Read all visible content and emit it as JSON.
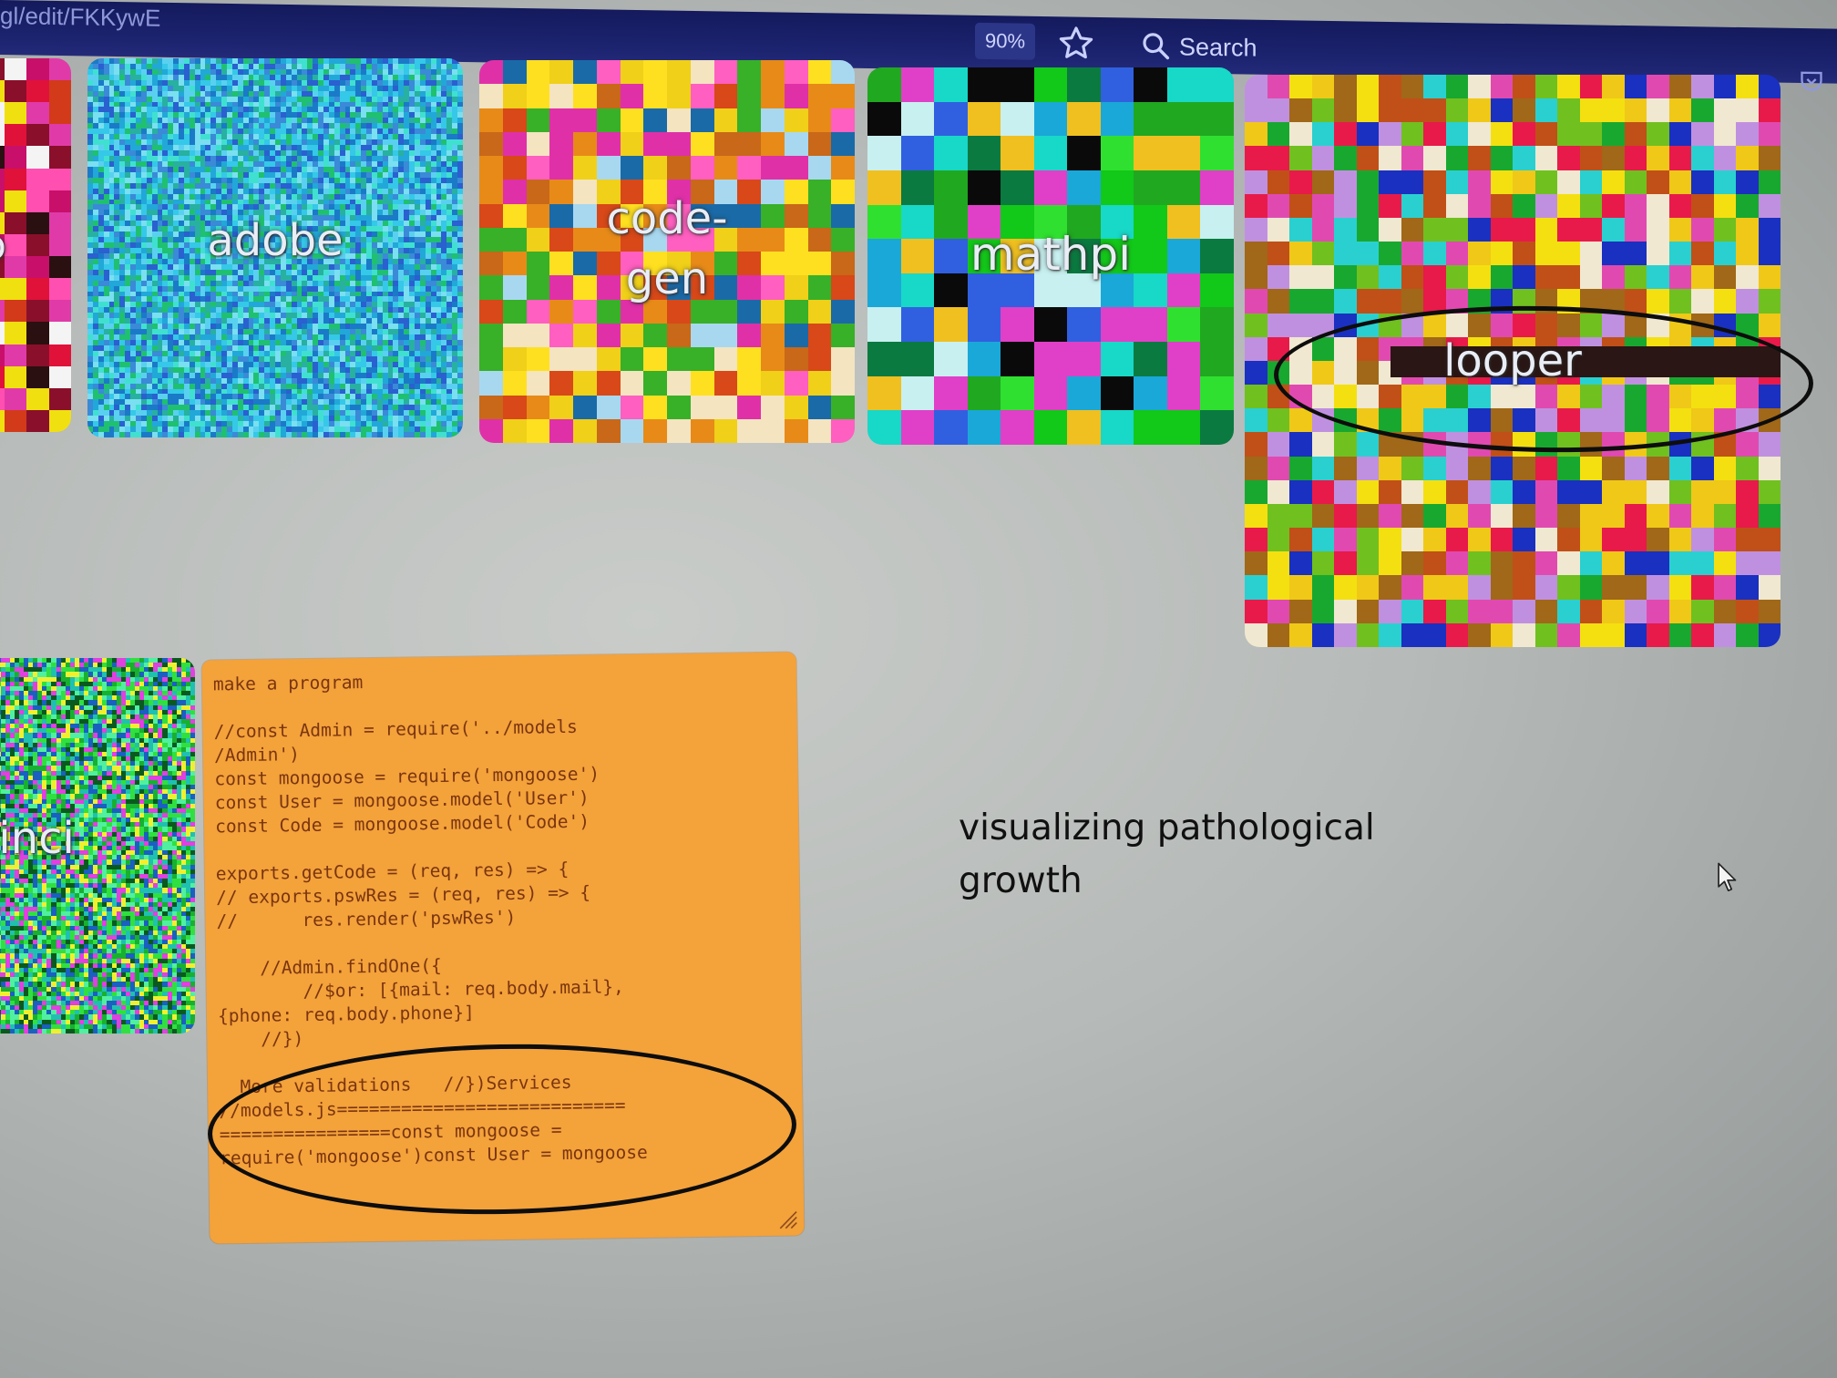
{
  "browser": {
    "url_fragment": "gl/edit/FKKywE",
    "zoom_level": "90%",
    "search_label": "Search",
    "icons": [
      "star-icon",
      "search-icon",
      "pocket-icon"
    ]
  },
  "tiles": [
    {
      "label": "o",
      "palette": "red-magenta-yellow"
    },
    {
      "label": "adobe",
      "palette": "cyan-blue-noise"
    },
    {
      "label": "code-",
      "label2": "gen",
      "palette": "orange-yellow-magenta"
    },
    {
      "label": "mathpi",
      "palette": "green-cyan"
    },
    {
      "label": "looper",
      "palette": "multi-warm"
    },
    {
      "label": "vinci",
      "palette": "green-noise"
    }
  ],
  "note": {
    "text": "make a program\n\n//const Admin = require('../models\n/Admin')\nconst mongoose = require('mongoose')\nconst User = mongoose.model('User')\nconst Code = mongoose.model('Code')\n\nexports.getCode = (req, res) => {\n// exports.pswRes = (req, res) => {\n//      res.render('pswRes')\n\n    //Admin.findOne({\n        //$or: [{mail: req.body.mail},\n{phone: req.body.phone}]\n    //})\n\n  More validations   //})Services\n//models.js===========================\n================const mongoose =\nrequire('mongoose')const User = mongoose"
  },
  "caption": {
    "line1": "visualizing pathological",
    "line2": "growth"
  },
  "annotations": {
    "ellipse_color": "#0d0d0d"
  }
}
